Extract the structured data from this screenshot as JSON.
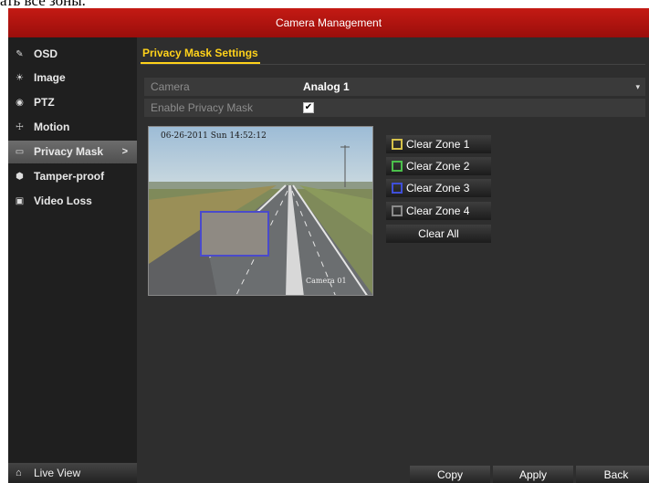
{
  "caption": "ать все зоны.",
  "window": {
    "title": "Camera Management"
  },
  "sidebar": {
    "items": [
      {
        "label": "OSD",
        "icon": "osd-icon",
        "glyph": "✎"
      },
      {
        "label": "Image",
        "icon": "image-icon",
        "glyph": "☀"
      },
      {
        "label": "PTZ",
        "icon": "ptz-icon",
        "glyph": "◉"
      },
      {
        "label": "Motion",
        "icon": "motion-icon",
        "glyph": "☩"
      },
      {
        "label": "Privacy Mask",
        "icon": "privacy-mask-icon",
        "glyph": "▭",
        "active": true
      },
      {
        "label": "Tamper-proof",
        "icon": "tamper-proof-icon",
        "glyph": "⬢"
      },
      {
        "label": "Video Loss",
        "icon": "video-loss-icon",
        "glyph": "▣"
      }
    ],
    "active_arrow": ">",
    "live_view": {
      "label": "Live View",
      "icon": "home-icon",
      "glyph": "⌂"
    }
  },
  "content": {
    "tab": "Privacy Mask Settings",
    "camera": {
      "label": "Camera",
      "value": "Analog 1",
      "dropdown_glyph": "▾"
    },
    "enable": {
      "label": "Enable Privacy Mask",
      "checked": true,
      "check_glyph": "✔"
    },
    "preview": {
      "timestamp": "06-26-2011 Sun 14:52:12",
      "camera_label": "Camera 01"
    },
    "zones": [
      {
        "label": "Clear Zone 1",
        "color": "#d6c24a"
      },
      {
        "label": "Clear Zone 2",
        "color": "#4bbf4b"
      },
      {
        "label": "Clear Zone 3",
        "color": "#3f4fd8"
      },
      {
        "label": "Clear Zone 4",
        "color": "#8a8a8a"
      }
    ],
    "clear_all": "Clear All"
  },
  "footer": {
    "copy": "Copy",
    "apply": "Apply",
    "back": "Back"
  },
  "colors": {
    "accent": "#ffd21a",
    "titlebar": "#b81510",
    "mask_border": "#4a4acb"
  }
}
